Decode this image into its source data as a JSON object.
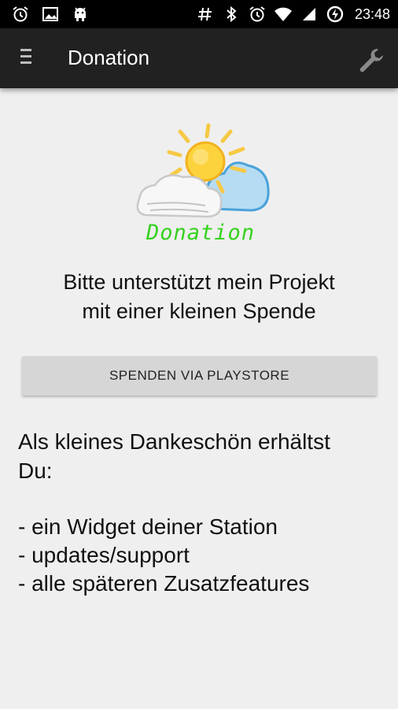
{
  "status_bar": {
    "time": "23:48",
    "left_icons": [
      "alarm-icon",
      "image-icon",
      "android-debug-icon"
    ],
    "right_icons": [
      "hash-icon",
      "bluetooth-icon",
      "alarm-icon",
      "wifi-icon",
      "signal-icon",
      "battery-charging-icon"
    ]
  },
  "action_bar": {
    "title": "Donation",
    "menu_icon": "hamburger-menu-icon",
    "settings_icon": "wrench-icon"
  },
  "logo": {
    "text": "Donation",
    "text_color": "#33d11c"
  },
  "content": {
    "intro_line1": "Bitte unterstützt mein Projekt",
    "intro_line2": "mit einer kleinen Spende",
    "button_label": "SPENDEN VIA PLAYSTORE",
    "thanks_line1": "Als kleines Dankeschön erhältst",
    "thanks_line2": "Du:",
    "benefits": [
      "- ein Widget deiner Station",
      "- updates/support",
      "- alle späteren Zusatzfeatures"
    ]
  },
  "colors": {
    "background": "#efefef",
    "action_bar": "#212121",
    "status_bar": "#000000",
    "button": "#d6d6d6"
  }
}
